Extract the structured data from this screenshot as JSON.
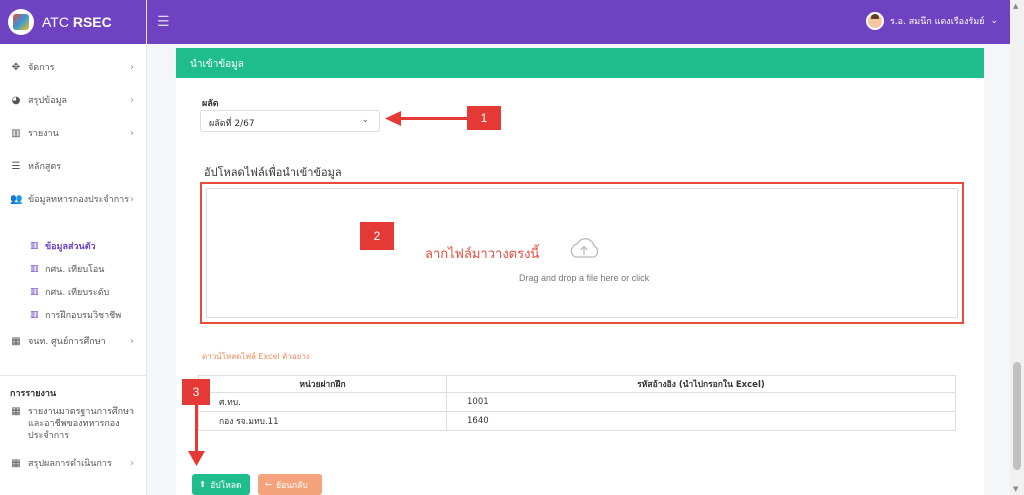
{
  "brand": {
    "prefix": "ATC",
    "name": "RSEC"
  },
  "topbar": {
    "user_name": "ร.อ. สมนึก แดงเรืองรัมย์",
    "user_chevron": "⌄"
  },
  "sidebar": {
    "items": [
      {
        "label": "จัดการ",
        "icon": "arrows-icon"
      },
      {
        "label": "สรุปข้อมูล",
        "icon": "pie-chart-icon"
      },
      {
        "label": "รายงาน",
        "icon": "bar-chart-icon"
      },
      {
        "label": "หลักสูตร",
        "icon": "list-icon"
      },
      {
        "label": "ข้อมูลทหารกองประจำการ",
        "icon": "users-icon"
      }
    ],
    "subitems": [
      {
        "label": "ข้อมูลส่วนตัว",
        "active": true
      },
      {
        "label": "กศน. เทียบโอน",
        "active": false
      },
      {
        "label": "กศน. เทียบระดับ",
        "active": false
      },
      {
        "label": "การฝึกอบรมวิชาชีพ",
        "active": false
      }
    ],
    "center_item": "จนท. ศูนย์การศึกษา",
    "section_title": "การรายงาน",
    "report_item": "รายงานมาตรฐานการศึกษาและอาชีพของทหารกองประจำการ",
    "report_item2": "สรุปผลการดำเนินการ"
  },
  "card": {
    "header": "นำเข้าข้อมูล",
    "term_label": "ผลัด",
    "term_value": "ผลัดที่ 2/67",
    "upload_title": "อัปโหลดไฟล์เพื่อนำเข้าข้อมูล",
    "drop_overlay": "ลากไฟล์มาวางตรงนี้",
    "drop_hint": "Drag and drop a file here or click",
    "download_link": "ดาวน์โหลดไฟล์ Excel ตัวอย่าง",
    "table": {
      "headers": [
        "หน่วยฝากฝึก",
        "รหัสอ้างอิง (นำไปกรอกใน Excel)"
      ],
      "rows": [
        [
          "ศ.ทบ.",
          "1001"
        ],
        [
          "กอง รจ.มทบ.11",
          "1640"
        ]
      ]
    },
    "upload_button": "อัปโหลด",
    "back_button": "ย้อนกลับ"
  },
  "annotations": {
    "badge1": "1",
    "badge2": "2",
    "badge3": "3"
  },
  "colors": {
    "primary": "#6f42c1",
    "success": "#1fbd8c",
    "annotation": "#e53935",
    "back": "#f4a37c"
  }
}
